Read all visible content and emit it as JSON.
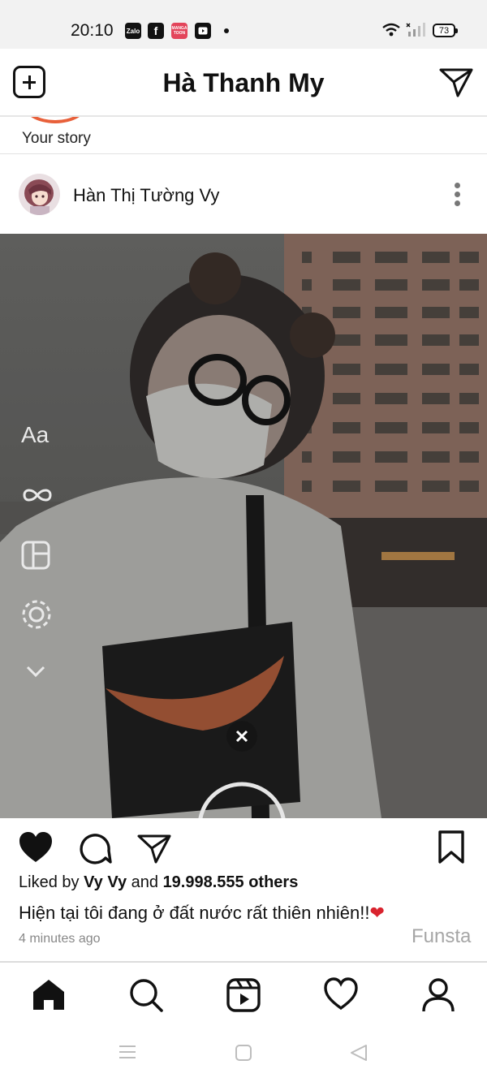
{
  "status_bar": {
    "time": "20:10",
    "app_icons": [
      "Zalo",
      "f",
      "MANGA TOON",
      "play"
    ],
    "battery": "73"
  },
  "header": {
    "title": "Hà Thanh My"
  },
  "story": {
    "label": "Your story",
    "ring_color": "#e8603a"
  },
  "post": {
    "username": "Hàn Thị Tường Vy",
    "photo_tools": [
      "Aa",
      "infinity-icon",
      "layout-icon",
      "focus-icon",
      "chevron-down-icon"
    ],
    "likes": {
      "prefix": "Liked by",
      "user": "Vy Vy",
      "joiner": "and",
      "count": "19.998.555 others"
    },
    "caption": "Hiện tại tôi đang ở đất nước rất thiên nhiên!!",
    "caption_emoji": "❤",
    "time_ago": "4 minutes ago",
    "watermark": "Funsta"
  },
  "bottom_nav": [
    "home-icon",
    "search-icon",
    "reels-icon",
    "heart-icon",
    "profile-icon"
  ],
  "system_nav": [
    "menu-icon",
    "home-square-icon",
    "back-icon"
  ]
}
